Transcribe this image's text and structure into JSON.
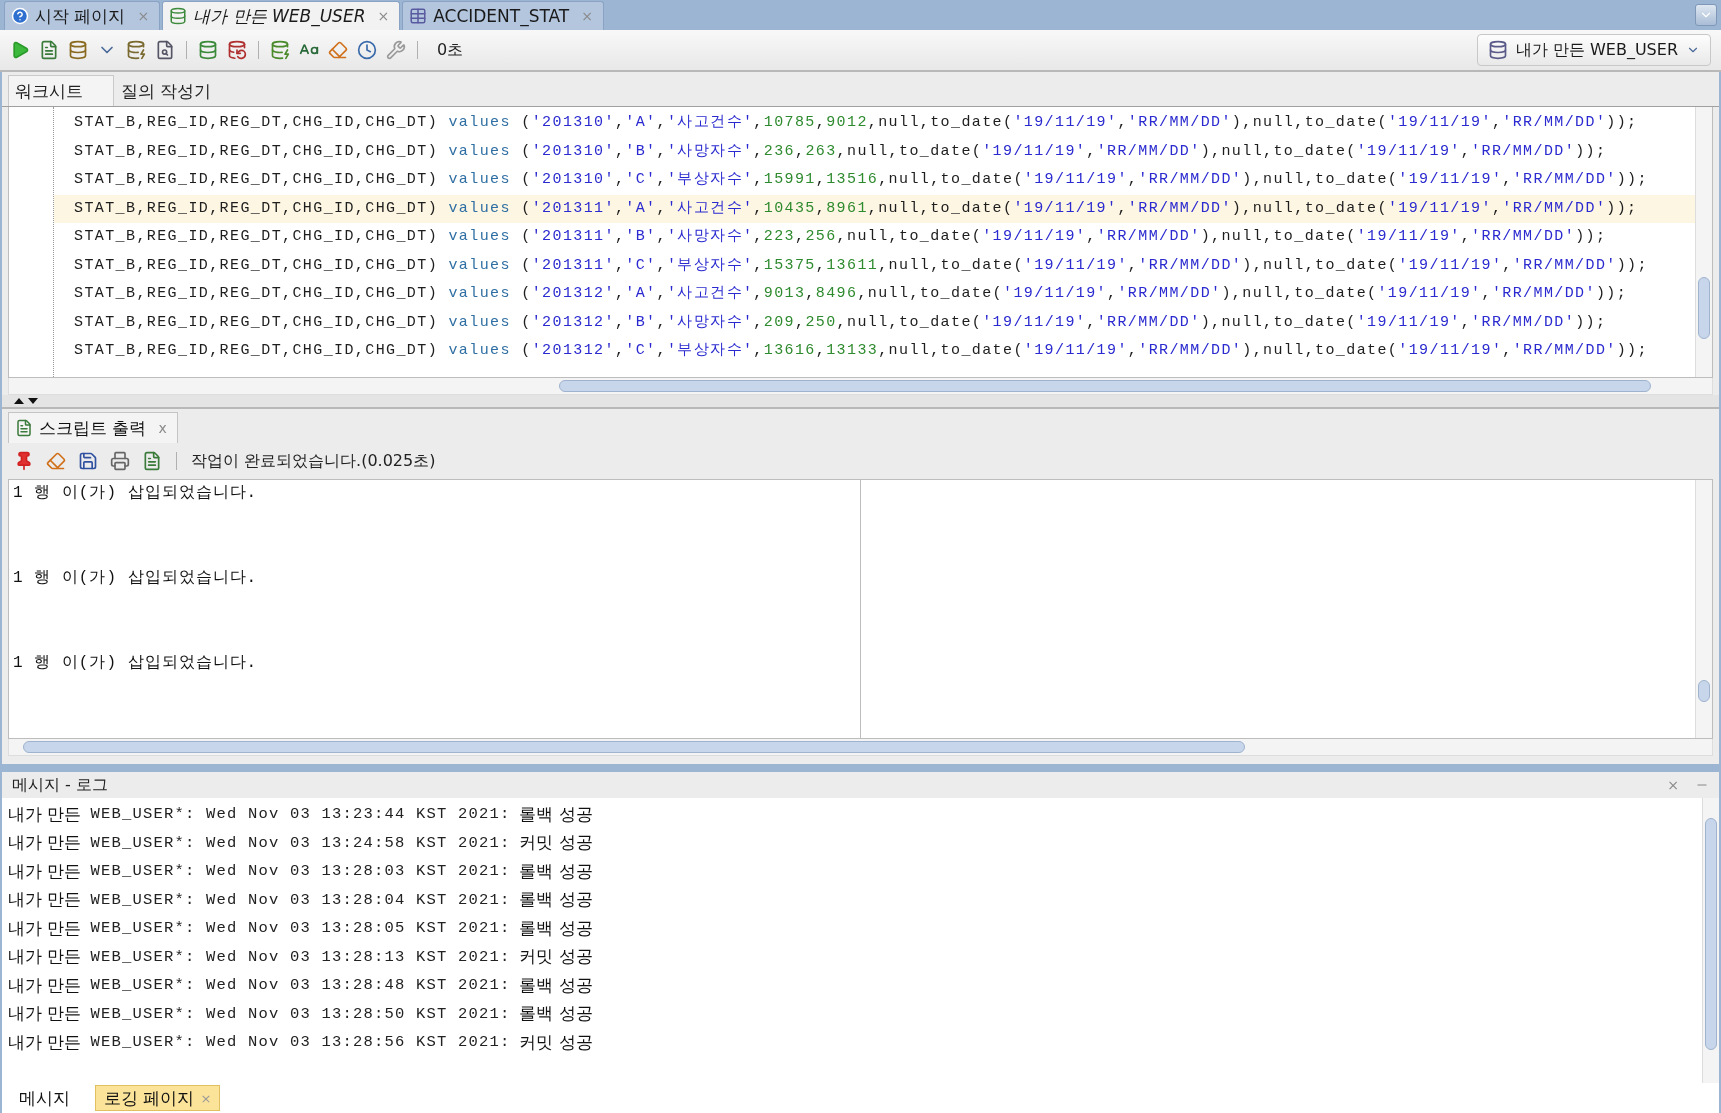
{
  "doc_tabs": [
    {
      "label": "시작 페이지",
      "selected": false,
      "kind": "help",
      "close": "×"
    },
    {
      "label": "내가 만든 WEB_USER",
      "selected": true,
      "kind": "sql",
      "close": "×"
    },
    {
      "label": "ACCIDENT_STAT",
      "selected": false,
      "kind": "table",
      "close": "×"
    }
  ],
  "toolbar": {
    "elapsed": "0초",
    "connection": "내가 만든 WEB_USER"
  },
  "editor_tabs": [
    {
      "label": "워크시트",
      "selected": true
    },
    {
      "label": "질의 작성기",
      "selected": false
    }
  ],
  "code_lines": [
    {
      "current": false,
      "tokens": [
        {
          "kind": "plain",
          "t": "STAT_B,REG_ID,REG_DT,CHG_ID,CHG_DT) "
        },
        {
          "kind": "keyword",
          "t": "values"
        },
        {
          "kind": "plain",
          "t": " ("
        },
        {
          "kind": "string",
          "t": "'201310'"
        },
        {
          "kind": "plain",
          "t": ","
        },
        {
          "kind": "string",
          "t": "'A'"
        },
        {
          "kind": "plain",
          "t": ","
        },
        {
          "kind": "string",
          "t": "'사고건수'"
        },
        {
          "kind": "plain",
          "t": ","
        },
        {
          "kind": "number",
          "t": "10785"
        },
        {
          "kind": "plain",
          "t": ","
        },
        {
          "kind": "number",
          "t": "9012"
        },
        {
          "kind": "plain",
          "t": ",null,to_date("
        },
        {
          "kind": "string",
          "t": "'19/11/19'"
        },
        {
          "kind": "plain",
          "t": ","
        },
        {
          "kind": "string",
          "t": "'RR/MM/DD'"
        },
        {
          "kind": "plain",
          "t": "),null,to_date("
        },
        {
          "kind": "string",
          "t": "'19/11/19'"
        },
        {
          "kind": "plain",
          "t": ","
        },
        {
          "kind": "string",
          "t": "'RR/MM/DD'"
        },
        {
          "kind": "plain",
          "t": "));"
        }
      ]
    },
    {
      "current": false,
      "tokens": [
        {
          "kind": "plain",
          "t": "STAT_B,REG_ID,REG_DT,CHG_ID,CHG_DT) "
        },
        {
          "kind": "keyword",
          "t": "values"
        },
        {
          "kind": "plain",
          "t": " ("
        },
        {
          "kind": "string",
          "t": "'201310'"
        },
        {
          "kind": "plain",
          "t": ","
        },
        {
          "kind": "string",
          "t": "'B'"
        },
        {
          "kind": "plain",
          "t": ","
        },
        {
          "kind": "string",
          "t": "'사망자수'"
        },
        {
          "kind": "plain",
          "t": ","
        },
        {
          "kind": "number",
          "t": "236"
        },
        {
          "kind": "plain",
          "t": ","
        },
        {
          "kind": "number",
          "t": "263"
        },
        {
          "kind": "plain",
          "t": ",null,to_date("
        },
        {
          "kind": "string",
          "t": "'19/11/19'"
        },
        {
          "kind": "plain",
          "t": ","
        },
        {
          "kind": "string",
          "t": "'RR/MM/DD'"
        },
        {
          "kind": "plain",
          "t": "),null,to_date("
        },
        {
          "kind": "string",
          "t": "'19/11/19'"
        },
        {
          "kind": "plain",
          "t": ","
        },
        {
          "kind": "string",
          "t": "'RR/MM/DD'"
        },
        {
          "kind": "plain",
          "t": "));"
        }
      ]
    },
    {
      "current": false,
      "tokens": [
        {
          "kind": "plain",
          "t": "STAT_B,REG_ID,REG_DT,CHG_ID,CHG_DT) "
        },
        {
          "kind": "keyword",
          "t": "values"
        },
        {
          "kind": "plain",
          "t": " ("
        },
        {
          "kind": "string",
          "t": "'201310'"
        },
        {
          "kind": "plain",
          "t": ","
        },
        {
          "kind": "string",
          "t": "'C'"
        },
        {
          "kind": "plain",
          "t": ","
        },
        {
          "kind": "string",
          "t": "'부상자수'"
        },
        {
          "kind": "plain",
          "t": ","
        },
        {
          "kind": "number",
          "t": "15991"
        },
        {
          "kind": "plain",
          "t": ","
        },
        {
          "kind": "number",
          "t": "13516"
        },
        {
          "kind": "plain",
          "t": ",null,to_date("
        },
        {
          "kind": "string",
          "t": "'19/11/19'"
        },
        {
          "kind": "plain",
          "t": ","
        },
        {
          "kind": "string",
          "t": "'RR/MM/DD'"
        },
        {
          "kind": "plain",
          "t": "),null,to_date("
        },
        {
          "kind": "string",
          "t": "'19/11/19'"
        },
        {
          "kind": "plain",
          "t": ","
        },
        {
          "kind": "string",
          "t": "'RR/MM/DD'"
        },
        {
          "kind": "plain",
          "t": "));"
        }
      ]
    },
    {
      "current": true,
      "tokens": [
        {
          "kind": "plain",
          "t": "STAT_B,REG_ID,REG_DT,CHG_ID,CHG_DT) "
        },
        {
          "kind": "keyword",
          "t": "values"
        },
        {
          "kind": "plain",
          "t": " ("
        },
        {
          "kind": "string",
          "t": "'201311'"
        },
        {
          "kind": "plain",
          "t": ","
        },
        {
          "kind": "string",
          "t": "'A'"
        },
        {
          "kind": "plain",
          "t": ","
        },
        {
          "kind": "string",
          "t": "'사고건수'"
        },
        {
          "kind": "plain",
          "t": ","
        },
        {
          "kind": "number",
          "t": "10435"
        },
        {
          "kind": "plain",
          "t": ","
        },
        {
          "kind": "number",
          "t": "8961"
        },
        {
          "kind": "plain",
          "t": ",null,to_date("
        },
        {
          "kind": "string",
          "t": "'19/11/19'"
        },
        {
          "kind": "plain",
          "t": ","
        },
        {
          "kind": "string",
          "t": "'RR/MM/DD'"
        },
        {
          "kind": "plain",
          "t": "),null,to_date("
        },
        {
          "kind": "string",
          "t": "'19/11/19'"
        },
        {
          "kind": "plain",
          "t": ","
        },
        {
          "kind": "string",
          "t": "'RR/MM/DD'"
        },
        {
          "kind": "plain",
          "t": "));"
        }
      ]
    },
    {
      "current": false,
      "tokens": [
        {
          "kind": "plain",
          "t": "STAT_B,REG_ID,REG_DT,CHG_ID,CHG_DT) "
        },
        {
          "kind": "keyword",
          "t": "values"
        },
        {
          "kind": "plain",
          "t": " ("
        },
        {
          "kind": "string",
          "t": "'201311'"
        },
        {
          "kind": "plain",
          "t": ","
        },
        {
          "kind": "string",
          "t": "'B'"
        },
        {
          "kind": "plain",
          "t": ","
        },
        {
          "kind": "string",
          "t": "'사망자수'"
        },
        {
          "kind": "plain",
          "t": ","
        },
        {
          "kind": "number",
          "t": "223"
        },
        {
          "kind": "plain",
          "t": ","
        },
        {
          "kind": "number",
          "t": "256"
        },
        {
          "kind": "plain",
          "t": ",null,to_date("
        },
        {
          "kind": "string",
          "t": "'19/11/19'"
        },
        {
          "kind": "plain",
          "t": ","
        },
        {
          "kind": "string",
          "t": "'RR/MM/DD'"
        },
        {
          "kind": "plain",
          "t": "),null,to_date("
        },
        {
          "kind": "string",
          "t": "'19/11/19'"
        },
        {
          "kind": "plain",
          "t": ","
        },
        {
          "kind": "string",
          "t": "'RR/MM/DD'"
        },
        {
          "kind": "plain",
          "t": "));"
        }
      ]
    },
    {
      "current": false,
      "tokens": [
        {
          "kind": "plain",
          "t": "STAT_B,REG_ID,REG_DT,CHG_ID,CHG_DT) "
        },
        {
          "kind": "keyword",
          "t": "values"
        },
        {
          "kind": "plain",
          "t": " ("
        },
        {
          "kind": "string",
          "t": "'201311'"
        },
        {
          "kind": "plain",
          "t": ","
        },
        {
          "kind": "string",
          "t": "'C'"
        },
        {
          "kind": "plain",
          "t": ","
        },
        {
          "kind": "string",
          "t": "'부상자수'"
        },
        {
          "kind": "plain",
          "t": ","
        },
        {
          "kind": "number",
          "t": "15375"
        },
        {
          "kind": "plain",
          "t": ","
        },
        {
          "kind": "number",
          "t": "13611"
        },
        {
          "kind": "plain",
          "t": ",null,to_date("
        },
        {
          "kind": "string",
          "t": "'19/11/19'"
        },
        {
          "kind": "plain",
          "t": ","
        },
        {
          "kind": "string",
          "t": "'RR/MM/DD'"
        },
        {
          "kind": "plain",
          "t": "),null,to_date("
        },
        {
          "kind": "string",
          "t": "'19/11/19'"
        },
        {
          "kind": "plain",
          "t": ","
        },
        {
          "kind": "string",
          "t": "'RR/MM/DD'"
        },
        {
          "kind": "plain",
          "t": "));"
        }
      ]
    },
    {
      "current": false,
      "tokens": [
        {
          "kind": "plain",
          "t": "STAT_B,REG_ID,REG_DT,CHG_ID,CHG_DT) "
        },
        {
          "kind": "keyword",
          "t": "values"
        },
        {
          "kind": "plain",
          "t": " ("
        },
        {
          "kind": "string",
          "t": "'201312'"
        },
        {
          "kind": "plain",
          "t": ","
        },
        {
          "kind": "string",
          "t": "'A'"
        },
        {
          "kind": "plain",
          "t": ","
        },
        {
          "kind": "string",
          "t": "'사고건수'"
        },
        {
          "kind": "plain",
          "t": ","
        },
        {
          "kind": "number",
          "t": "9013"
        },
        {
          "kind": "plain",
          "t": ","
        },
        {
          "kind": "number",
          "t": "8496"
        },
        {
          "kind": "plain",
          "t": ",null,to_date("
        },
        {
          "kind": "string",
          "t": "'19/11/19'"
        },
        {
          "kind": "plain",
          "t": ","
        },
        {
          "kind": "string",
          "t": "'RR/MM/DD'"
        },
        {
          "kind": "plain",
          "t": "),null,to_date("
        },
        {
          "kind": "string",
          "t": "'19/11/19'"
        },
        {
          "kind": "plain",
          "t": ","
        },
        {
          "kind": "string",
          "t": "'RR/MM/DD'"
        },
        {
          "kind": "plain",
          "t": "));"
        }
      ]
    },
    {
      "current": false,
      "tokens": [
        {
          "kind": "plain",
          "t": "STAT_B,REG_ID,REG_DT,CHG_ID,CHG_DT) "
        },
        {
          "kind": "keyword",
          "t": "values"
        },
        {
          "kind": "plain",
          "t": " ("
        },
        {
          "kind": "string",
          "t": "'201312'"
        },
        {
          "kind": "plain",
          "t": ","
        },
        {
          "kind": "string",
          "t": "'B'"
        },
        {
          "kind": "plain",
          "t": ","
        },
        {
          "kind": "string",
          "t": "'사망자수'"
        },
        {
          "kind": "plain",
          "t": ","
        },
        {
          "kind": "number",
          "t": "209"
        },
        {
          "kind": "plain",
          "t": ","
        },
        {
          "kind": "number",
          "t": "250"
        },
        {
          "kind": "plain",
          "t": ",null,to_date("
        },
        {
          "kind": "string",
          "t": "'19/11/19'"
        },
        {
          "kind": "plain",
          "t": ","
        },
        {
          "kind": "string",
          "t": "'RR/MM/DD'"
        },
        {
          "kind": "plain",
          "t": "),null,to_date("
        },
        {
          "kind": "string",
          "t": "'19/11/19'"
        },
        {
          "kind": "plain",
          "t": ","
        },
        {
          "kind": "string",
          "t": "'RR/MM/DD'"
        },
        {
          "kind": "plain",
          "t": "));"
        }
      ]
    },
    {
      "current": false,
      "tokens": [
        {
          "kind": "plain",
          "t": "STAT_B,REG_ID,REG_DT,CHG_ID,CHG_DT) "
        },
        {
          "kind": "keyword",
          "t": "values"
        },
        {
          "kind": "plain",
          "t": " ("
        },
        {
          "kind": "string",
          "t": "'201312'"
        },
        {
          "kind": "plain",
          "t": ","
        },
        {
          "kind": "string",
          "t": "'C'"
        },
        {
          "kind": "plain",
          "t": ","
        },
        {
          "kind": "string",
          "t": "'부상자수'"
        },
        {
          "kind": "plain",
          "t": ","
        },
        {
          "kind": "number",
          "t": "13616"
        },
        {
          "kind": "plain",
          "t": ","
        },
        {
          "kind": "number",
          "t": "13133"
        },
        {
          "kind": "plain",
          "t": ",null,to_date("
        },
        {
          "kind": "string",
          "t": "'19/11/19'"
        },
        {
          "kind": "plain",
          "t": ","
        },
        {
          "kind": "string",
          "t": "'RR/MM/DD'"
        },
        {
          "kind": "plain",
          "t": "),null,to_date("
        },
        {
          "kind": "string",
          "t": "'19/11/19'"
        },
        {
          "kind": "plain",
          "t": ","
        },
        {
          "kind": "string",
          "t": "'RR/MM/DD'"
        },
        {
          "kind": "plain",
          "t": "));"
        }
      ]
    }
  ],
  "script_output": {
    "tab": {
      "label": "스크립트 출력",
      "close": "x"
    },
    "status": "작업이 완료되었습니다.(0.025초)",
    "lines": [
      "1 행 이(가) 삽입되었습니다.",
      "1 행 이(가) 삽입되었습니다.",
      "1 행 이(가) 삽입되었습니다."
    ]
  },
  "messages": {
    "title": "메시지 - 로그",
    "close": "×",
    "rows": [
      {
        "connection": "내가 만든",
        "stamp": "WEB_USER*: Wed Nov 03 13:23:44 KST 2021:",
        "result": "롤백 성공"
      },
      {
        "connection": "내가 만든",
        "stamp": "WEB_USER*: Wed Nov 03 13:24:58 KST 2021:",
        "result": "커밋 성공"
      },
      {
        "connection": "내가 만든",
        "stamp": "WEB_USER*: Wed Nov 03 13:28:03 KST 2021:",
        "result": "롤백 성공"
      },
      {
        "connection": "내가 만든",
        "stamp": "WEB_USER*: Wed Nov 03 13:28:04 KST 2021:",
        "result": "롤백 성공"
      },
      {
        "connection": "내가 만든",
        "stamp": "WEB_USER*: Wed Nov 03 13:28:05 KST 2021:",
        "result": "롤백 성공"
      },
      {
        "connection": "내가 만든",
        "stamp": "WEB_USER*: Wed Nov 03 13:28:13 KST 2021:",
        "result": "커밋 성공"
      },
      {
        "connection": "내가 만든",
        "stamp": "WEB_USER*: Wed Nov 03 13:28:48 KST 2021:",
        "result": "롤백 성공"
      },
      {
        "connection": "내가 만든",
        "stamp": "WEB_USER*: Wed Nov 03 13:28:50 KST 2021:",
        "result": "롤백 성공"
      },
      {
        "connection": "내가 만든",
        "stamp": "WEB_USER*: Wed Nov 03 13:28:56 KST 2021:",
        "result": "커밋 성공"
      }
    ],
    "tabs": [
      {
        "label": "메시지",
        "selected": false
      },
      {
        "label": "로깅 페이지",
        "selected": true,
        "close": "×"
      }
    ]
  }
}
